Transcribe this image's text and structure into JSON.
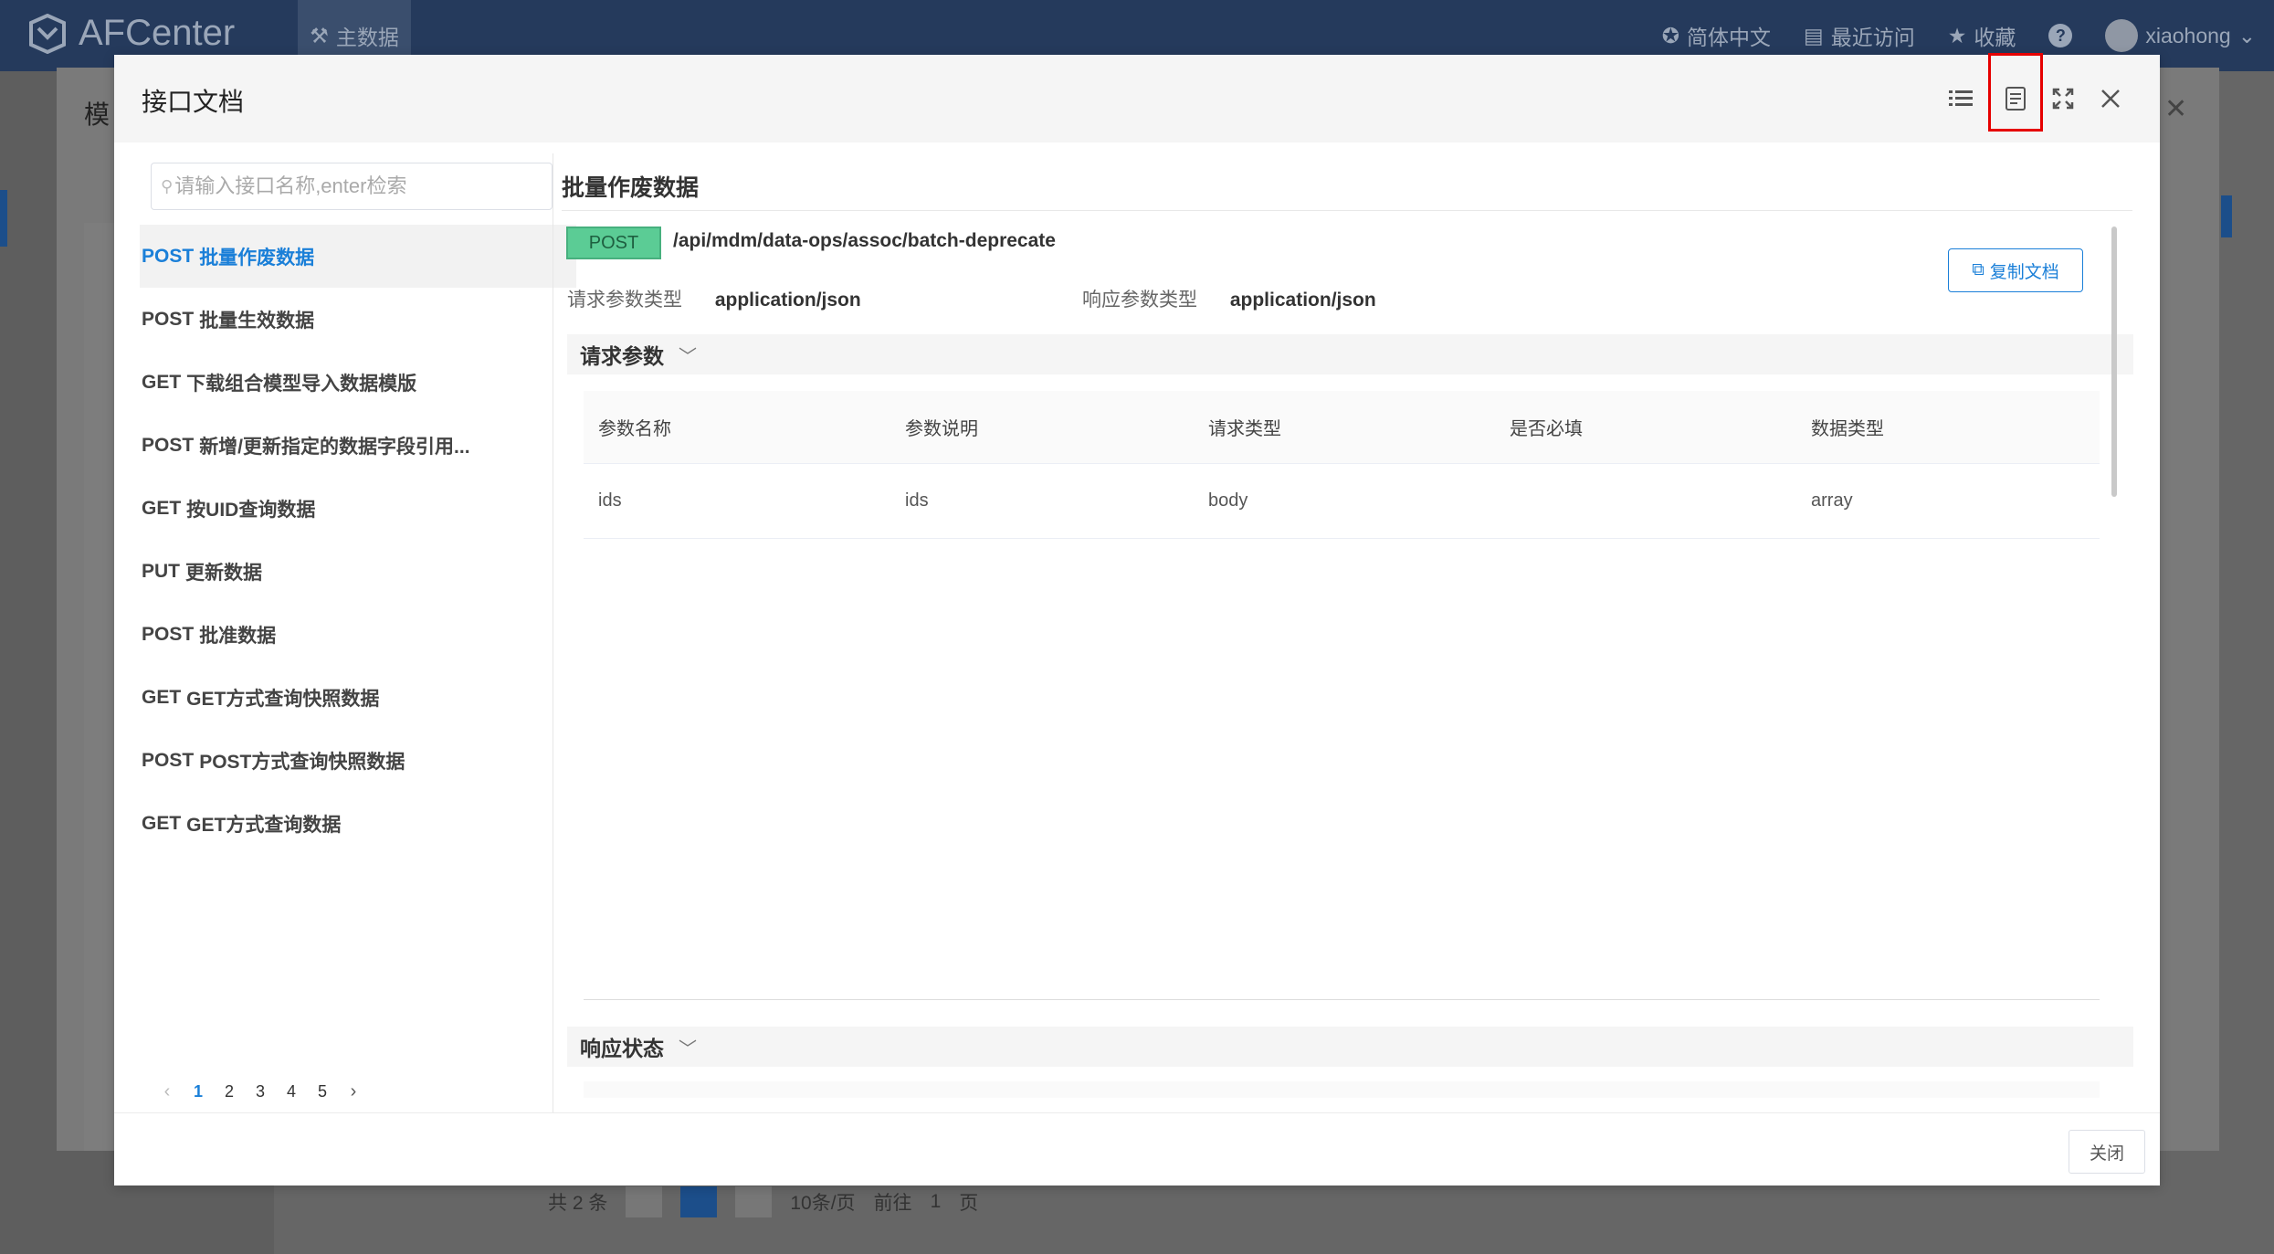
{
  "app": {
    "logo_text": "AFCenter",
    "nav_label": "主数据",
    "language": "简体中文",
    "recent": "最近访问",
    "favorites": "收藏",
    "help": "?",
    "user": "xiaohong"
  },
  "background": {
    "modal_title": "模",
    "pager_total": "共 2 条",
    "pager_current": "1",
    "page_size": "10条/页",
    "goto_label": "前往",
    "goto_value": "1",
    "goto_unit": "页"
  },
  "dialog": {
    "title": "接口文档",
    "search_placeholder": "请输入接口名称,enter检索",
    "apis": [
      {
        "method": "POST",
        "name": "批量作废数据"
      },
      {
        "method": "POST",
        "name": "批量生效数据"
      },
      {
        "method": "GET",
        "name": "下载组合模型导入数据模版"
      },
      {
        "method": "POST",
        "name": "新增/更新指定的数据字段引用..."
      },
      {
        "method": "GET",
        "name": "按UID查询数据"
      },
      {
        "method": "PUT",
        "name": "更新数据"
      },
      {
        "method": "POST",
        "name": "批准数据"
      },
      {
        "method": "GET",
        "name": "GET方式查询快照数据"
      },
      {
        "method": "POST",
        "name": "POST方式查询快照数据"
      },
      {
        "method": "GET",
        "name": "GET方式查询数据"
      }
    ],
    "pages": [
      "1",
      "2",
      "3",
      "4",
      "5"
    ],
    "doc": {
      "title": "批量作废数据",
      "method": "POST",
      "path": "/api/mdm/data-ops/assoc/batch-deprecate",
      "copy_label": "复制文档",
      "req_type_label": "请求参数类型",
      "req_type_value": "application/json",
      "resp_type_label": "响应参数类型",
      "resp_type_value": "application/json",
      "req_section": "请求参数",
      "resp_section": "响应状态",
      "columns": [
        "参数名称",
        "参数说明",
        "请求类型",
        "是否必填",
        "数据类型"
      ],
      "rows": [
        [
          "ids",
          "ids",
          "body",
          "",
          "array"
        ]
      ]
    },
    "close_label": "关闭"
  },
  "colors": {
    "topbar": "#253a5c",
    "accent": "#1a7fd8",
    "method_post": "#5bcc95",
    "highlight": "#e60000"
  }
}
